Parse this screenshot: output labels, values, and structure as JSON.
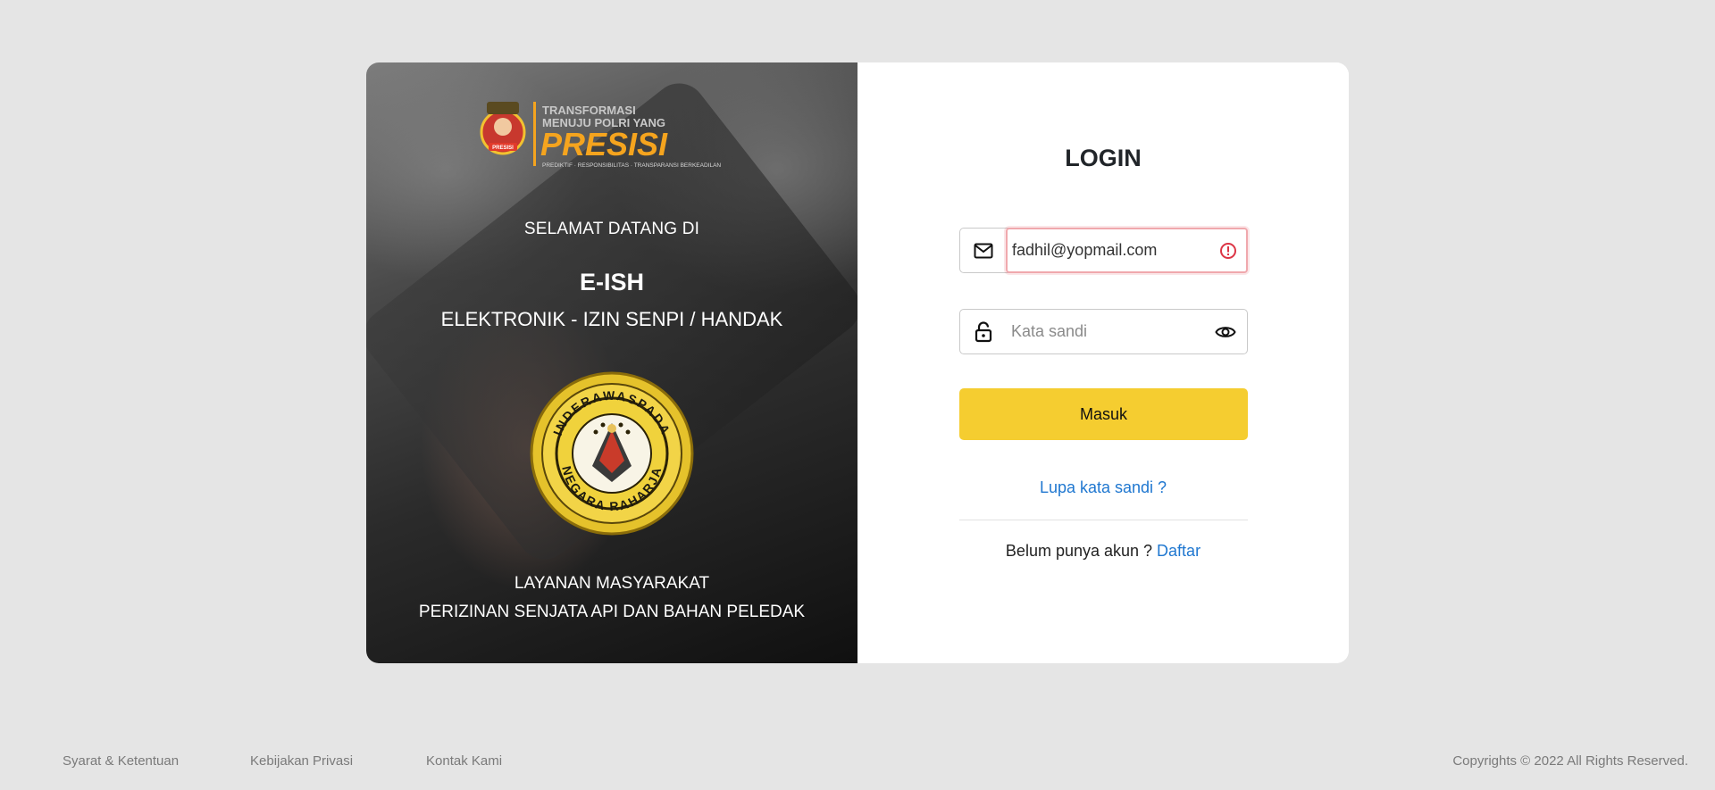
{
  "left_panel": {
    "logo": {
      "line1": "TRANSFORMASI",
      "line2": "MENUJU POLRI YANG",
      "word": "PRESISI",
      "tagline": "PREDIKTIF · RESPONSIBILITAS · TRANSPARANSI BERKEADILAN",
      "badge_text": "PRESISI"
    },
    "welcome": "SELAMAT DATANG DI",
    "brand": "E-ISH",
    "brand_sub": "ELEKTRONIK - IZIN SENPI / HANDAK",
    "emblem": {
      "top_text": "INDERAWASPADA",
      "bottom_text": "NEGARA RAHARJA"
    },
    "service_line1": "LAYANAN MASYARAKAT",
    "service_line2": "PERIZINAN SENJATA API DAN BAHAN PELEDAK"
  },
  "login": {
    "title": "LOGIN",
    "email_value": "fadhil@yopmail.com",
    "email_icon": "mail-icon",
    "email_error_icon": "alert-circle-icon",
    "password_placeholder": "Kata sandi",
    "password_icon": "lock-icon",
    "toggle_icon": "eye-icon",
    "submit_label": "Masuk",
    "forgot_label": "Lupa kata sandi ?",
    "register_prompt": "Belum punya akun ?",
    "register_link": "Daftar"
  },
  "footer": {
    "links": [
      "Syarat & Ketentuan",
      "Kebijakan Privasi",
      "Kontak Kami"
    ],
    "copyright": "Copyrights © 2022 All Rights Reserved."
  },
  "colors": {
    "page_bg": "#e5e5e5",
    "accent_button": "#f5cd30",
    "link": "#1f77d0",
    "error": "#dc3545"
  }
}
